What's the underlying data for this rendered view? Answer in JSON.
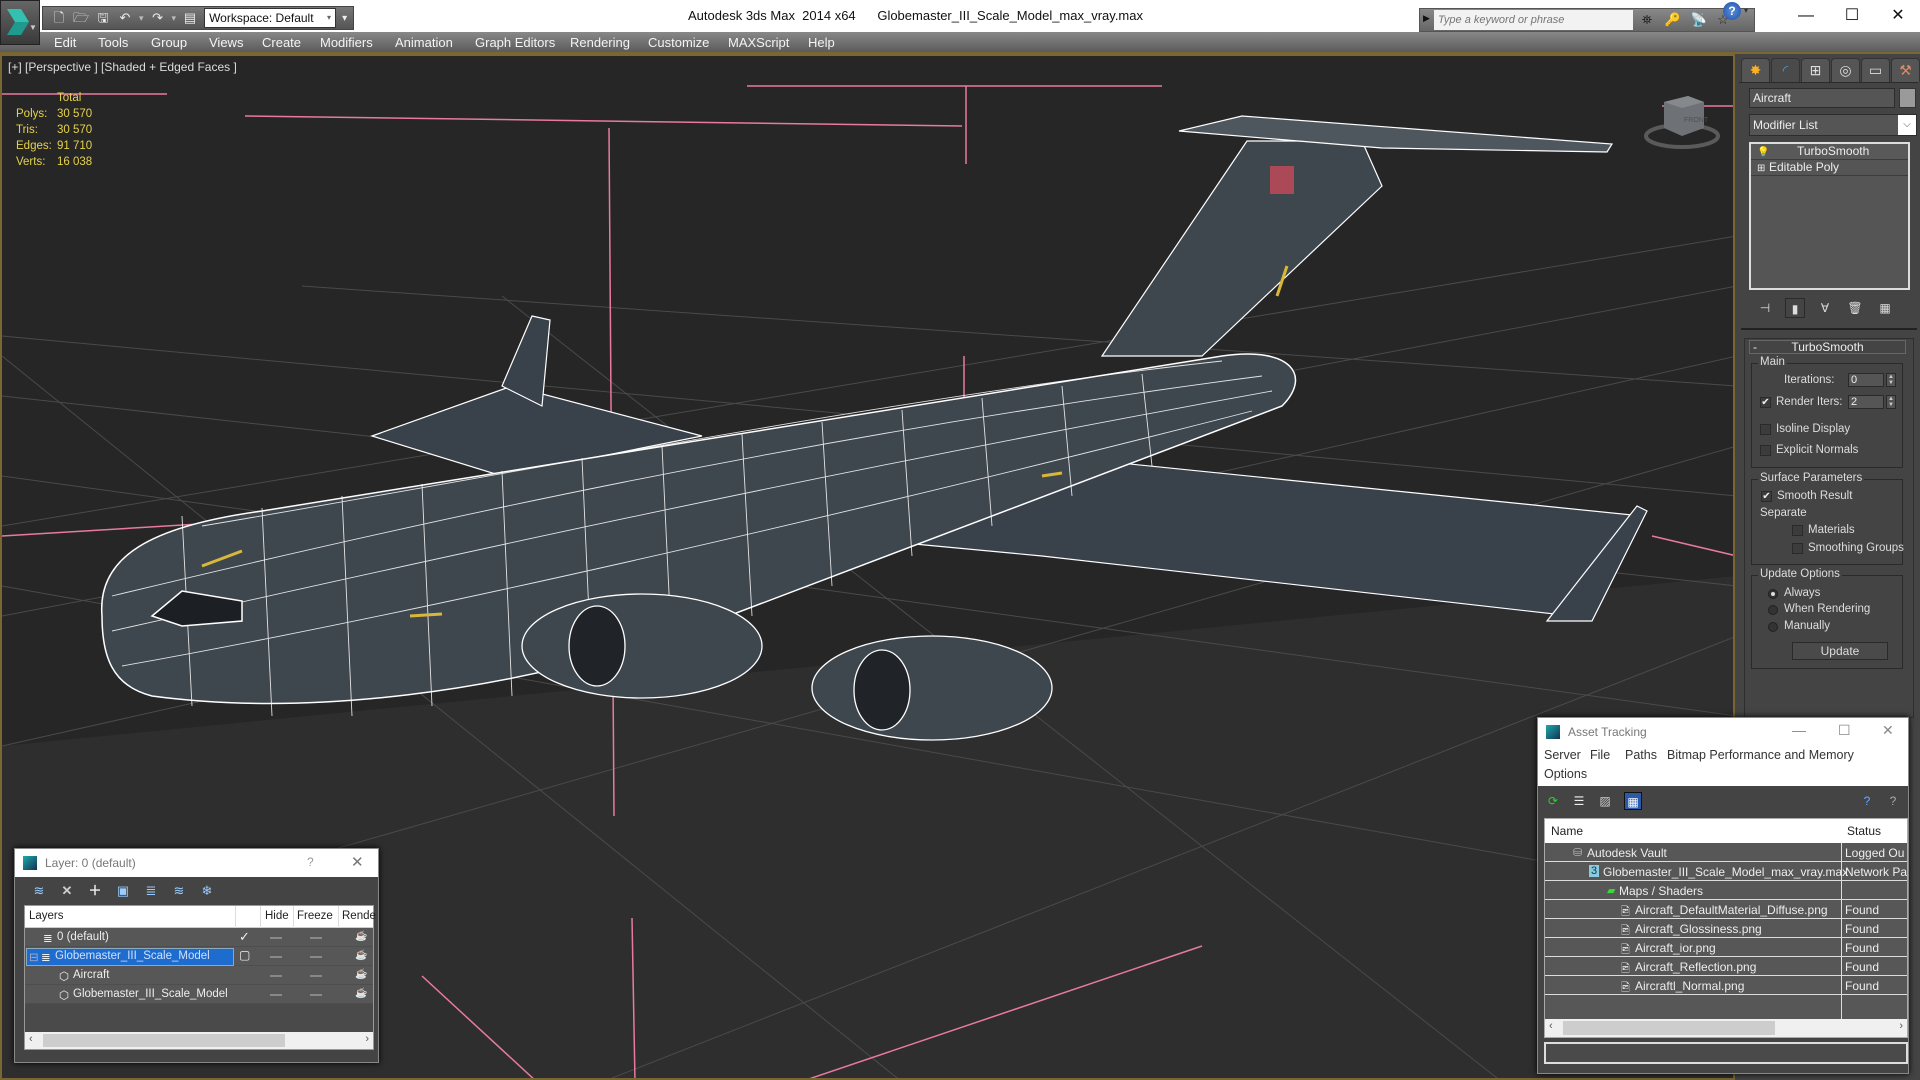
{
  "app": {
    "window_title": "Autodesk 3ds Max  2014 x64      Globemaster_III_Scale_Model_max_vray.max",
    "workspace": "Workspace: Default",
    "search_placeholder": "Type a keyword or phrase",
    "window_controls": [
      "minimize",
      "maximize",
      "close"
    ]
  },
  "quick_toolbar": [
    "new-file",
    "open-file",
    "save-file",
    "undo",
    "redo",
    "project-folder"
  ],
  "menu": [
    "Edit",
    "Tools",
    "Group",
    "Views",
    "Create",
    "Modifiers",
    "Animation",
    "Graph Editors",
    "Rendering",
    "Customize",
    "MAXScript",
    "Help"
  ],
  "viewport": {
    "label": "[+] [Perspective ] [Shaded + Edged Faces ]",
    "stats": {
      "header": "Total",
      "rows": [
        {
          "label": "Polys:",
          "value": "30 570"
        },
        {
          "label": "Tris:",
          "value": "30 570"
        },
        {
          "label": "Edges:",
          "value": "91 710"
        },
        {
          "label": "Verts:",
          "value": "16 038"
        }
      ]
    },
    "viewcube_face": "FRONT",
    "colors": {
      "background": "#262626",
      "grid": "#4a4a4a",
      "wire": "#ffffff",
      "hull": "#3f474e",
      "helper_lines": "#e87aa0",
      "stats_text": "#e6d24a"
    }
  },
  "command_panel": {
    "tabs": [
      "create",
      "modify",
      "hierarchy",
      "motion",
      "display",
      "utilities"
    ],
    "object_name": "Aircraft",
    "modifier_list": "Modifier List",
    "stack": [
      {
        "label": "TurboSmooth",
        "icon": "lightbulb"
      },
      {
        "label": "Editable Poly",
        "icon": "plus-box"
      }
    ],
    "turbosmooth": {
      "title": "TurboSmooth",
      "main_title": "Main",
      "iterations_label": "Iterations:",
      "iterations": "0",
      "render_iters_label": "Render Iters:",
      "render_iters": "2",
      "render_iters_checked": true,
      "isoline_display": "Isoline Display",
      "explicit_normals": "Explicit Normals",
      "surface_title": "Surface Parameters",
      "smooth_result": "Smooth Result",
      "separate": "Separate",
      "materials": "Materials",
      "smoothing_groups": "Smoothing Groups",
      "update_title": "Update Options",
      "always": "Always",
      "when_rendering": "When Rendering",
      "manually": "Manually",
      "update_button": "Update"
    }
  },
  "layer_window": {
    "title": "Layer: 0 (default)",
    "help": "?",
    "columns": [
      "Layers",
      "",
      "Hide",
      "Freeze",
      "Rende"
    ],
    "rows": [
      {
        "name": "0 (default)",
        "current": true,
        "selected": false,
        "indent": 1
      },
      {
        "name": "Globemaster_III_Scale_Model",
        "current": false,
        "selected": true,
        "indent": 0
      },
      {
        "name": "Aircraft",
        "current": false,
        "selected": false,
        "indent": 2
      },
      {
        "name": "Globemaster_III_Scale_Model",
        "current": false,
        "selected": false,
        "indent": 2
      }
    ]
  },
  "asset_window": {
    "title": "Asset Tracking",
    "menu": [
      "Server",
      "File",
      "Paths",
      "Bitmap Performance and Memory",
      "Options"
    ],
    "columns": [
      "Name",
      "Status"
    ],
    "rows": [
      {
        "name": "Autodesk Vault",
        "status": "Logged Ou",
        "indent": 1,
        "icon": "vault"
      },
      {
        "name": "Globemaster_III_Scale_Model_max_vray.max",
        "status": "Network Pa",
        "indent": 2,
        "icon": "max-file"
      },
      {
        "name": "Maps / Shaders",
        "status": "",
        "indent": 3,
        "icon": "maps"
      },
      {
        "name": "Aircraft_DefaultMaterial_Diffuse.png",
        "status": "Found",
        "indent": 4,
        "icon": "image"
      },
      {
        "name": "Aircraft_Glossiness.png",
        "status": "Found",
        "indent": 4,
        "icon": "image"
      },
      {
        "name": "Aircraft_ior.png",
        "status": "Found",
        "indent": 4,
        "icon": "image"
      },
      {
        "name": "Aircraft_Reflection.png",
        "status": "Found",
        "indent": 4,
        "icon": "image"
      },
      {
        "name": "Aircraftl_Normal.png",
        "status": "Found",
        "indent": 4,
        "icon": "image"
      }
    ]
  }
}
